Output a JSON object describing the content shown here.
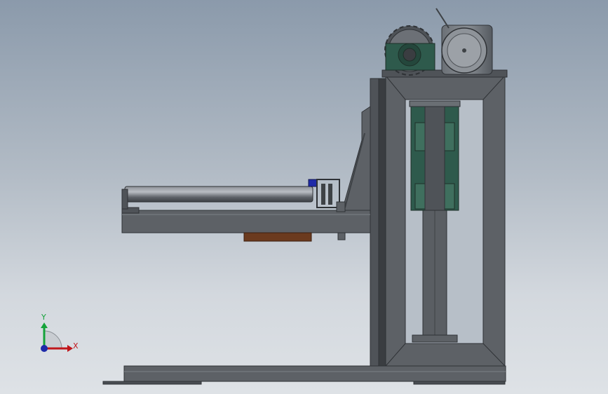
{
  "viewport": {
    "background_top": "#8b9aab",
    "background_bottom": "#dee2e6"
  },
  "model": {
    "parts": [
      {
        "name": "base-plate",
        "icon": "base-plate"
      },
      {
        "name": "lift-tower-frame",
        "icon": "rectangular-frame"
      },
      {
        "name": "linear-guide-rail",
        "icon": "guide-rail"
      },
      {
        "name": "drive-motor",
        "icon": "motor"
      },
      {
        "name": "drive-sprocket",
        "icon": "sprocket"
      },
      {
        "name": "pillow-block-bearing",
        "icon": "bearing"
      },
      {
        "name": "cantilever-arm",
        "icon": "arm"
      },
      {
        "name": "roller-cylinder",
        "icon": "cylinder"
      },
      {
        "name": "clamp-assembly",
        "icon": "clamp"
      }
    ],
    "colors": {
      "steel": "#5d6166",
      "steel_dark": "#3e4246",
      "steel_light": "#7c8187",
      "bearing_green": "#2e5a4c",
      "wood_pad": "#6b3a1e",
      "accent_blue": "#1e2aa8"
    }
  },
  "triad": {
    "x_label": "X",
    "y_label": "Y",
    "x_color": "#c0161b",
    "y_color": "#15a33a",
    "z_color": "#1e2aa8"
  }
}
